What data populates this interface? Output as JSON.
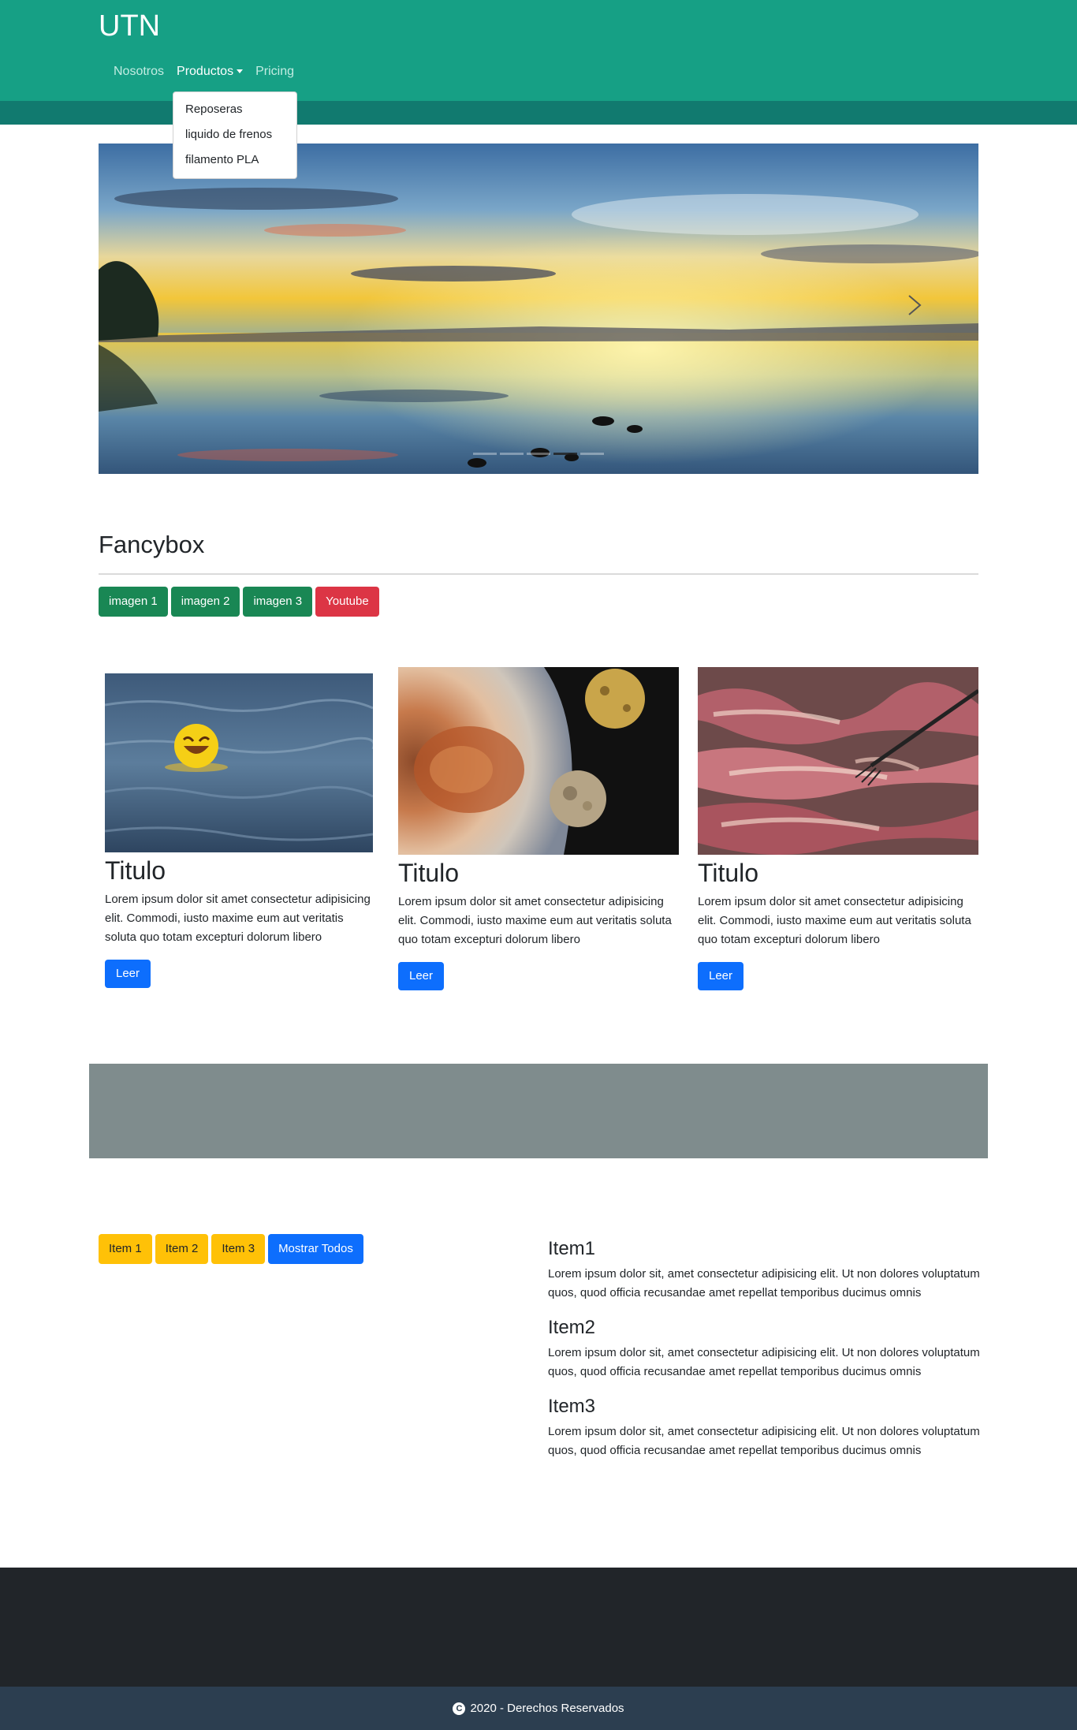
{
  "navbar": {
    "brand": "UTN",
    "links": [
      "Nosotros",
      "Productos",
      "Pricing"
    ],
    "dropdown": [
      "Reposeras",
      "liquido de frenos",
      "filamento PLA"
    ]
  },
  "carousel": {
    "indicator_count": 5,
    "active_index": 3
  },
  "fancybox": {
    "title": "Fancybox",
    "buttons": [
      "imagen 1",
      "imagen 2",
      "imagen 3",
      "Youtube"
    ]
  },
  "cards": [
    {
      "title": "Titulo",
      "text": "Lorem ipsum dolor sit amet consectetur adipisicing elit. Commodi, iusto maxime eum aut veritatis soluta quo totam excepturi dolorum libero",
      "button": "Leer"
    },
    {
      "title": "Titulo",
      "text": "Lorem ipsum dolor sit amet consectetur adipisicing elit. Commodi, iusto maxime eum aut veritatis soluta quo totam excepturi dolorum libero",
      "button": "Leer"
    },
    {
      "title": "Titulo",
      "text": "Lorem ipsum dolor sit amet consectetur adipisicing elit. Commodi, iusto maxime eum aut veritatis soluta quo totam excepturi dolorum libero",
      "button": "Leer"
    }
  ],
  "filter": {
    "buttons": [
      "Item 1",
      "Item 2",
      "Item 3",
      "Mostrar Todos"
    ]
  },
  "items": [
    {
      "title": "Item1",
      "text": "Lorem ipsum dolor sit, amet consectetur adipisicing elit. Ut non dolores voluptatum quos, quod officia recusandae amet repellat temporibus ducimus omnis"
    },
    {
      "title": "Item2",
      "text": "Lorem ipsum dolor sit, amet consectetur adipisicing elit. Ut non dolores voluptatum quos, quod officia recusandae amet repellat temporibus ducimus omnis"
    },
    {
      "title": "Item3",
      "text": "Lorem ipsum dolor sit, amet consectetur adipisicing elit. Ut non dolores voluptatum quos, quod officia recusandae amet repellat temporibus ducimus omnis"
    }
  ],
  "footer": {
    "copyright": "2020 - Derechos Reservados"
  },
  "colors": {
    "navbar": "#16a085",
    "navbar_strip": "#117a6f",
    "band": "#7f8c8d",
    "footer": "#212529",
    "copyright_bar": "#2c3e50"
  }
}
